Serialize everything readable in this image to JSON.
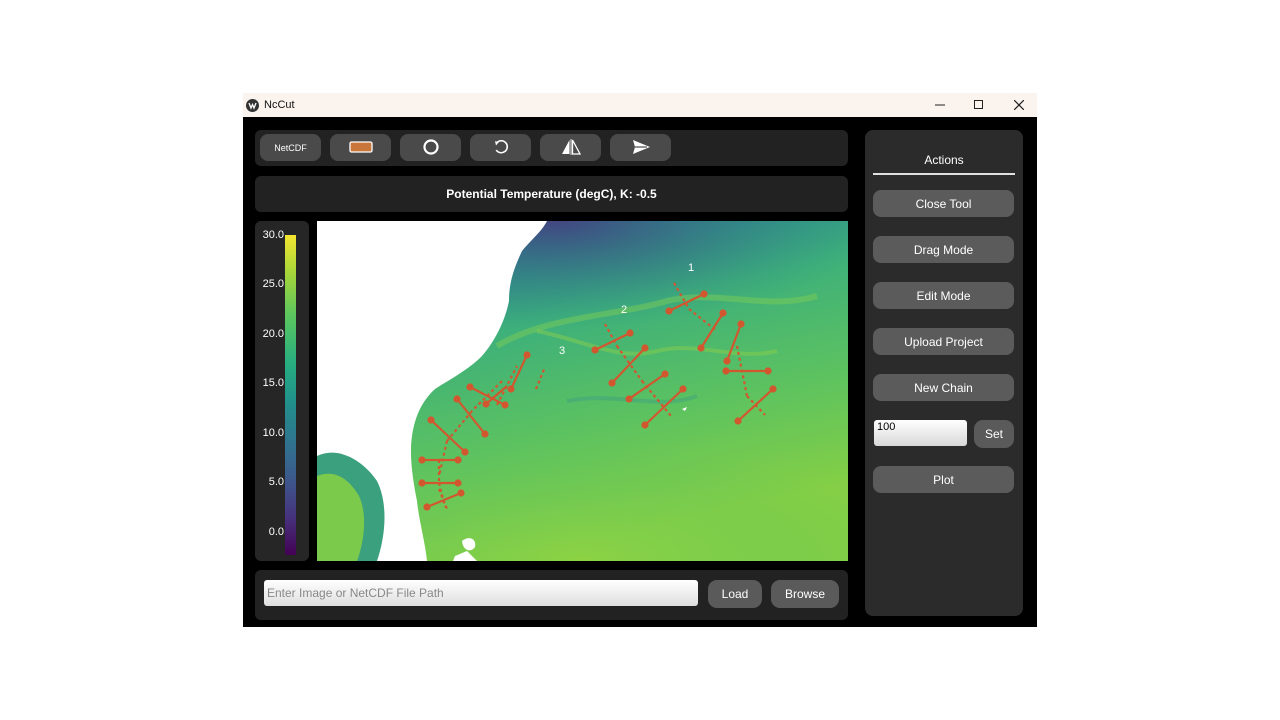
{
  "window": {
    "title": "NcCut",
    "controls": {
      "minimize": "minimize-icon",
      "maximize": "maximize-icon",
      "close": "close-icon"
    }
  },
  "toolbar": {
    "netcdf_label": "NetCDF",
    "buttons": [
      "netcdf-button",
      "rectangle-icon",
      "circle-icon",
      "rotate-icon",
      "flip-icon",
      "send-icon"
    ],
    "accent": "#c8763a"
  },
  "plot": {
    "title": "Potential Temperature (degC), K: -0.5"
  },
  "colorbar": {
    "ticks": [
      "30.0",
      "25.0",
      "20.0",
      "15.0",
      "10.0",
      "5.0",
      "0.0"
    ],
    "colormap": "viridis"
  },
  "map": {
    "transect_labels": [
      "1",
      "2",
      "3"
    ],
    "line_color": "#d2572f"
  },
  "file_bar": {
    "placeholder": "Enter Image or NetCDF File Path",
    "load_label": "Load",
    "browse_label": "Browse"
  },
  "sidebar": {
    "tab": "Actions",
    "buttons": {
      "close_tool": "Close Tool",
      "drag_mode": "Drag Mode",
      "edit_mode": "Edit Mode",
      "upload_project": "Upload Project",
      "new_chain": "New Chain",
      "set": "Set",
      "plot": "Plot"
    },
    "width_value": "100"
  }
}
